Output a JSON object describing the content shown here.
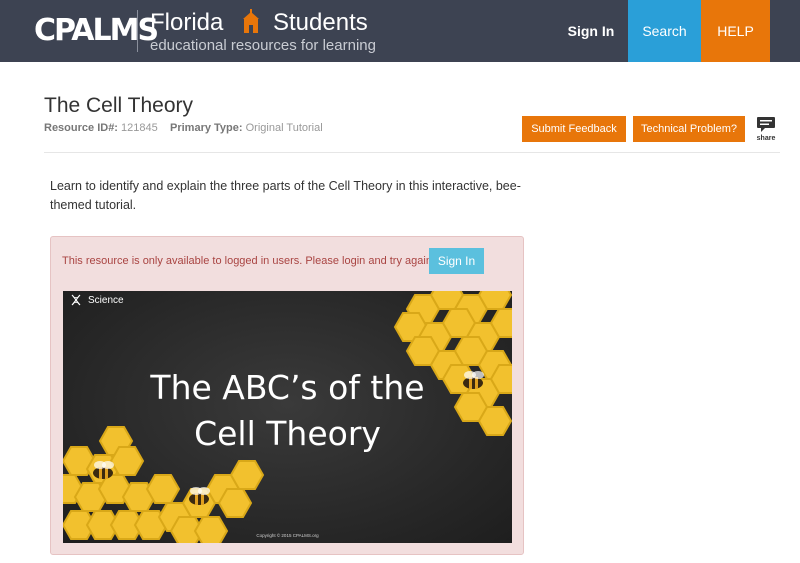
{
  "header": {
    "logo_text": "CPALMS",
    "brand_line1_a": "Florida",
    "brand_line1_b": "Students",
    "brand_line2": "educational resources for learning",
    "nav": {
      "signin": "Sign In",
      "search": "Search",
      "help": "HELP"
    }
  },
  "page": {
    "title": "The Cell Theory",
    "resource_id_label": "Resource ID#:",
    "resource_id_value": "121845",
    "primary_type_label": "Primary Type:",
    "primary_type_value": "Original Tutorial",
    "buttons": {
      "feedback": "Submit Feedback",
      "technical": "Technical Problem?"
    },
    "share_label": "share",
    "description": "Learn to identify and explain the three parts of the Cell Theory in this interactive, bee-themed tutorial."
  },
  "locked_panel": {
    "message": "This resource is only available to logged in users. Please login and try again.",
    "signin_label": "Sign In",
    "thumbnail": {
      "subject": "Science",
      "title_line1": "The ABC’s of the",
      "title_line2": "Cell Theory",
      "copyright": "Copyright © 2015 CPALMS.org"
    }
  },
  "colors": {
    "header_bg": "#3d4352",
    "search_bg": "#2a9fd8",
    "accent_orange": "#e8760a",
    "alert_bg": "#f2dede",
    "alert_text": "#a94442",
    "info_button": "#5bc0de",
    "honeycomb": "#f2c12e"
  },
  "icons": {
    "brand": "school-building-icon",
    "share": "speech-bubble-icon",
    "subject": "dna-icon",
    "bee": "bee-icon"
  }
}
